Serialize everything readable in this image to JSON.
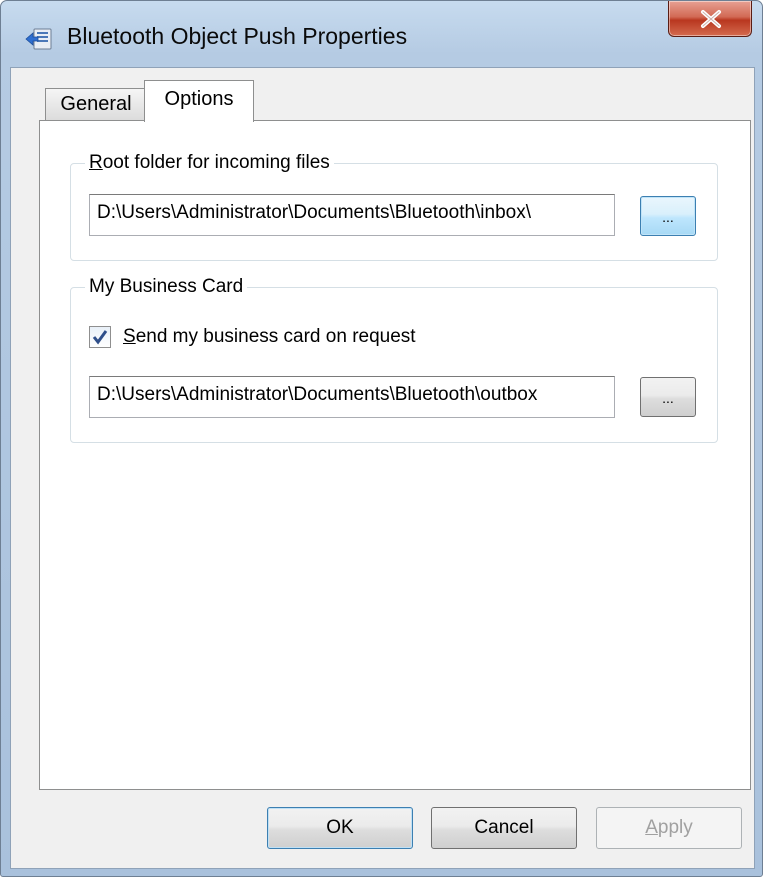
{
  "window": {
    "title": "Bluetooth Object Push Properties",
    "close_icon": "close-x-icon",
    "app_icon": "bluetooth-transfer-icon"
  },
  "tabs": [
    {
      "label": "General",
      "active": false
    },
    {
      "label": "Options",
      "active": true
    }
  ],
  "root_group": {
    "label_accel": "R",
    "label_rest": "oot folder for incoming files",
    "path": "D:\\Users\\Administrator\\Documents\\Bluetooth\\inbox\\",
    "browse_label": "..."
  },
  "card_group": {
    "label": "My Business Card",
    "checkbox_accel": "S",
    "checkbox_rest": "end my business card on request",
    "checked": true,
    "path": "D:\\Users\\Administrator\\Documents\\Bluetooth\\outbox",
    "browse_label": "..."
  },
  "buttons": {
    "ok": "OK",
    "cancel": "Cancel",
    "apply_accel": "A",
    "apply_rest": "pply",
    "apply_enabled": false
  },
  "colors": {
    "close_button": "#c8472f",
    "focus_border": "#3c7fb1",
    "disabled_text": "#a0a0a0"
  }
}
